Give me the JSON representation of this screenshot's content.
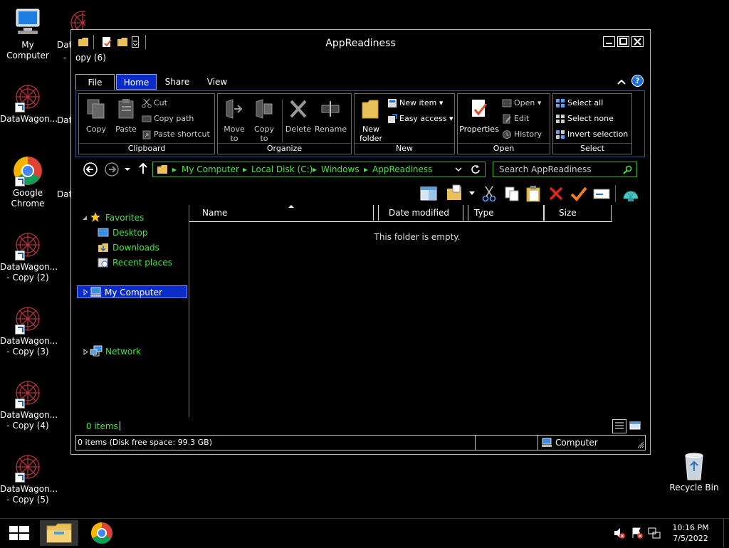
{
  "desktop": {
    "icons": [
      {
        "label": "My Computer"
      },
      {
        "label": "Dat"
      },
      {
        "label": "DataWagon..."
      },
      {
        "label": "Dat"
      },
      {
        "label": "Google Chrome"
      },
      {
        "label": "Dat"
      },
      {
        "label": "DataWagon... - Copy (2)"
      },
      {
        "label": "DataWagon... - Copy (3)"
      },
      {
        "label": "DataWagon... - Copy (4)"
      },
      {
        "label": "DataWagon... - Copy (5)"
      },
      {
        "label": "Recycle Bin"
      }
    ],
    "behind_window_text_1": "-",
    "behind_window_text_2": "opy (6)"
  },
  "window": {
    "title": "AppReadiness",
    "tabs": [
      "File",
      "Home",
      "Share",
      "View"
    ],
    "help": "?",
    "ribbon": {
      "clipboard": {
        "label": "Clipboard",
        "copy": "Copy",
        "paste": "Paste",
        "cut": "Cut",
        "copy_path": "Copy path",
        "paste_shortcut": "Paste shortcut"
      },
      "organize": {
        "label": "Organize",
        "move_to": "Move to",
        "copy_to": "Copy to",
        "delete": "Delete",
        "rename": "Rename"
      },
      "new": {
        "label": "New",
        "new_folder_1": "New",
        "new_folder_2": "folder",
        "new_item": "New item",
        "easy_access": "Easy access"
      },
      "open": {
        "label": "Open",
        "properties": "Properties",
        "open": "Open",
        "edit": "Edit",
        "history": "History"
      },
      "select": {
        "label": "Select",
        "select_all": "Select all",
        "select_none": "Select none",
        "invert": "Invert selection"
      }
    },
    "address": {
      "crumbs": [
        "My Computer",
        "Local Disk (C:)",
        "Windows",
        "AppReadiness"
      ],
      "search_placeholder": "Search AppReadiness"
    },
    "nav": {
      "favorites": "Favorites",
      "desktop": "Desktop",
      "downloads": "Downloads",
      "recent": "Recent places",
      "my_computer": "My Computer",
      "network": "Network"
    },
    "columns": [
      "Name",
      "Date modified",
      "Type",
      "Size"
    ],
    "empty_message": "This folder is empty.",
    "items_count": "0 items",
    "status_left": "0 items (Disk free space: 99.3 GB)",
    "status_right": "Computer"
  },
  "taskbar": {
    "time": "10:16 PM",
    "date": "7/5/2022"
  },
  "colors": {
    "accent_green": "#3fe63f",
    "selection_blue": "#0b2cc6"
  }
}
